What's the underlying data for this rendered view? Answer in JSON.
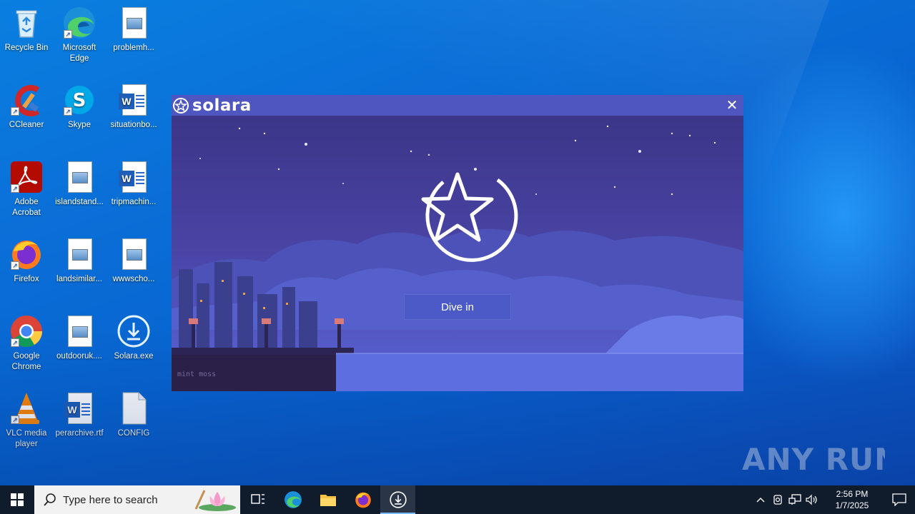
{
  "desktop": {
    "icons": [
      {
        "label": "Recycle Bin",
        "icon": "recycle-bin-icon"
      },
      {
        "label": "Microsoft Edge",
        "icon": "edge-icon"
      },
      {
        "label": "problemh...",
        "icon": "image-file-icon"
      },
      {
        "label": "CCleaner",
        "icon": "ccleaner-icon"
      },
      {
        "label": "Skype",
        "icon": "skype-icon"
      },
      {
        "label": "situationbo...",
        "icon": "word-doc-icon"
      },
      {
        "label": "Adobe Acrobat",
        "icon": "acrobat-icon"
      },
      {
        "label": "islandstand...",
        "icon": "image-file-icon"
      },
      {
        "label": "tripmachin...",
        "icon": "word-doc-icon"
      },
      {
        "label": "Firefox",
        "icon": "firefox-icon"
      },
      {
        "label": "landsimilar...",
        "icon": "image-file-icon"
      },
      {
        "label": "wwwscho...",
        "icon": "image-file-icon"
      },
      {
        "label": "Google Chrome",
        "icon": "chrome-icon"
      },
      {
        "label": "outdooruk....",
        "icon": "image-file-icon"
      },
      {
        "label": "Solara.exe",
        "icon": "solara-installer-icon"
      },
      {
        "label": "VLC media player",
        "icon": "vlc-icon"
      },
      {
        "label": "perarchive.rtf",
        "icon": "word-doc-icon"
      },
      {
        "label": "CONFIG",
        "icon": "blank-file-icon"
      }
    ]
  },
  "solara": {
    "title": "solara",
    "close_glyph": "✕",
    "dive_label": "Dive in",
    "art_credit": "mint moss",
    "accent": "#4f56c0"
  },
  "watermark": {
    "text": "ANY RUN"
  },
  "taskbar": {
    "search_placeholder": "Type here to search",
    "apps": [
      "task-view-icon",
      "edge-icon",
      "file-explorer-icon",
      "firefox-icon",
      "solara-installer-icon"
    ],
    "clock_time": "2:56 PM",
    "clock_date": "1/7/2025"
  }
}
